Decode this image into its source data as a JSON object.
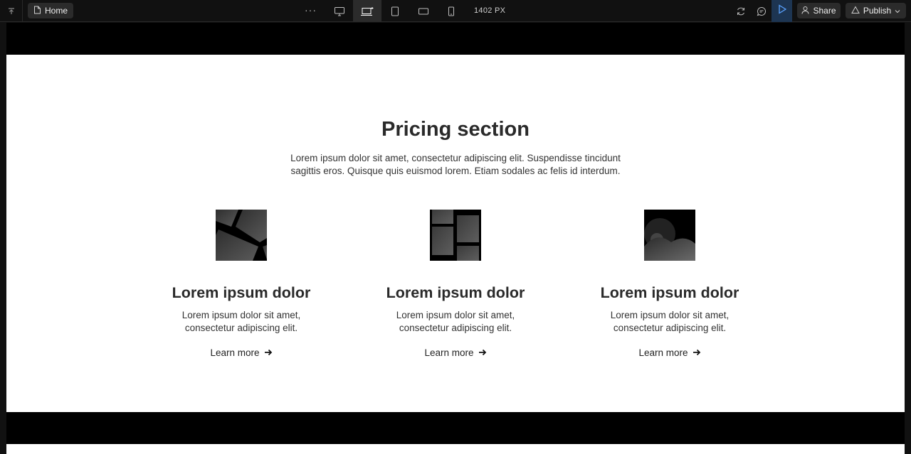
{
  "toolbar": {
    "page_label": "Home",
    "more_label": "···",
    "breakpoint_width": "1402 PX",
    "share_label": "Share",
    "publish_label": "Publish",
    "accent_color": "#1d3552"
  },
  "pricing": {
    "title": "Pricing section",
    "subtitle": "Lorem ipsum dolor sit amet, consectetur adipiscing elit. Suspendisse tincidunt sagittis eros. Quisque quis euismod lorem. Etiam sodales ac felis id interdum.",
    "cards": [
      {
        "title": "Lorem ipsum dolor",
        "text": "Lorem ipsum dolor sit amet, consectetur adipiscing elit.",
        "link": "Learn more",
        "icon": "photo-collage-tilted-icon"
      },
      {
        "title": "Lorem ipsum dolor",
        "text": "Lorem ipsum dolor sit amet, consectetur adipiscing elit.",
        "link": "Learn more",
        "icon": "photo-grid-icon"
      },
      {
        "title": "Lorem ipsum dolor",
        "text": "Lorem ipsum dolor sit amet, consectetur adipiscing elit.",
        "link": "Learn more",
        "icon": "abstract-shapes-icon"
      }
    ]
  }
}
